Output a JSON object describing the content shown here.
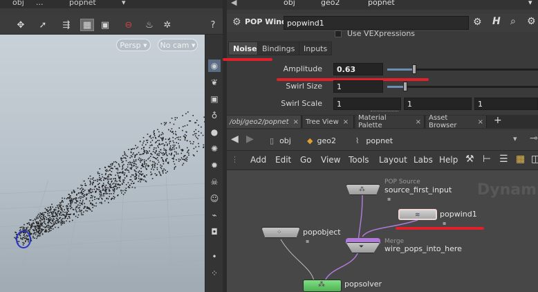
{
  "viewport": {
    "path": {
      "seg1": "obj",
      "seg2": "...",
      "seg3": "popnet"
    },
    "camera_menu": "Persp ▾",
    "display_menu": "No cam ▾"
  },
  "param": {
    "node_type": "POP Wind",
    "node_name": "popwind1",
    "vex_label": "Use VEXpressions",
    "tabs": [
      "Noise",
      "Bindings",
      "Inputs"
    ],
    "active_tab": "Noise",
    "rows": [
      {
        "label": "Amplitude",
        "value": "0.63",
        "fraction": 0.18
      },
      {
        "label": "Swirl Size",
        "value": "1",
        "fraction": 0.12
      },
      {
        "label": "Swirl Scale",
        "values": [
          "1",
          "1",
          "1"
        ]
      }
    ],
    "top_path": {
      "seg1": "obj",
      "seg2": "geo2",
      "seg3": "popnet"
    }
  },
  "network": {
    "tabs": [
      {
        "label": "/obj/geo2/popnet"
      },
      {
        "label": "Tree View"
      },
      {
        "label": "Material Palette"
      },
      {
        "label": "Asset Browser"
      }
    ],
    "add_tab": "+",
    "path": {
      "seg1": "obj",
      "seg2": "geo2",
      "seg3": "popnet"
    },
    "menu": [
      "Add",
      "Edit",
      "Go",
      "View",
      "Tools",
      "Layout",
      "Labs",
      "Help"
    ],
    "watermark": "Dynami",
    "nodes": {
      "source": {
        "type": "POP Source",
        "name": "source_first_input"
      },
      "wind": {
        "name": "popwind1"
      },
      "object": {
        "name": "popobject"
      },
      "merge": {
        "type": "Merge",
        "name": "wire_pops_into_here"
      },
      "solver": {
        "name": "popsolver"
      }
    }
  },
  "colors": {
    "annotation": "#e0202a",
    "solver_node": "#6fcf72",
    "merge_wire": "#b07ad8",
    "particles": "#222222",
    "emitter": "#2a34c8"
  }
}
